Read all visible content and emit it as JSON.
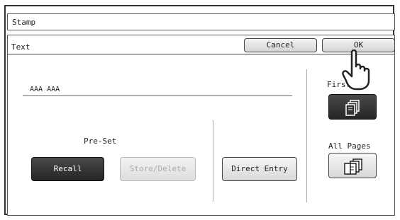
{
  "stamp_bar": {
    "label": "Stamp"
  },
  "panel": {
    "title": "Text",
    "cancel_label": "Cancel",
    "ok_label": "OK"
  },
  "text_entry": {
    "value": "AAA AAA"
  },
  "preset": {
    "label": "Pre-Set",
    "recall_label": "Recall",
    "store_delete_label": "Store/Delete"
  },
  "direct_entry_label": "Direct Entry",
  "pages": {
    "first_label": "First",
    "all_pages_label": "All Pages",
    "selected": "First"
  },
  "icons": {
    "first": "first-page-stack-icon",
    "all_pages": "all-pages-stack-icon",
    "pointer": "pointing-hand-icon"
  },
  "colors": {
    "selected_button": "#2e2e2e",
    "normal_button": "#e6e6e6",
    "disabled_text": "#aaaaaa"
  }
}
